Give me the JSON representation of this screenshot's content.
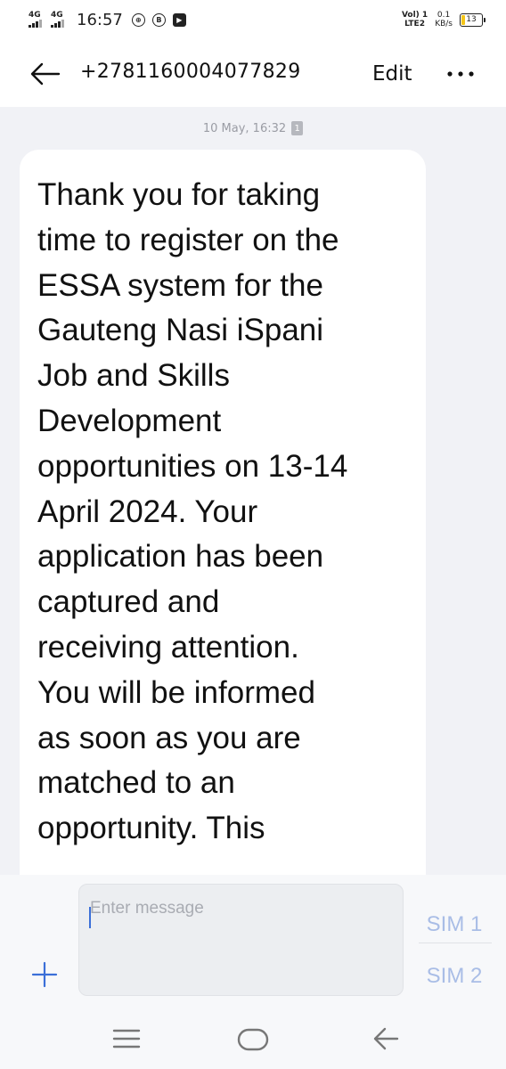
{
  "status_bar": {
    "signal_1_label": "4G",
    "signal_2_label": "4G",
    "time": "16:57",
    "icons": [
      "data-saver-icon",
      "b-icon",
      "youtube-icon"
    ],
    "volte_label": "VoLTE",
    "volte_line1": "Vol) 1",
    "volte_line2": "LTE2",
    "net_speed_value": "0.1",
    "net_speed_unit": "KB/s",
    "battery_level": "13"
  },
  "header": {
    "contact": "+2781160004077829",
    "edit_label": "Edit",
    "back_icon": "back-arrow-icon",
    "more_icon": "more-icon"
  },
  "conversation": {
    "timestamp": "10 May, 16:32",
    "sim_badge": "1",
    "message_text": "Thank you for taking\ntime to register on the\nESSA system for the\nGauteng Nasi iSpani\nJob and Skills\nDevelopment\nopportunities on 13-14\nApril 2024.  Your\napplication has been\ncaptured and\nreceiving attention.\nYou will be informed\nas soon as you are\nmatched to an\nopportunity. This"
  },
  "composer": {
    "placeholder": "Enter message",
    "value": "",
    "sim1_label": "SIM 1",
    "sim2_label": "SIM 2",
    "accent_color": "#3b6fd8"
  },
  "nav_bar": {
    "icons": [
      "menu-icon",
      "home-icon",
      "back-icon"
    ]
  }
}
